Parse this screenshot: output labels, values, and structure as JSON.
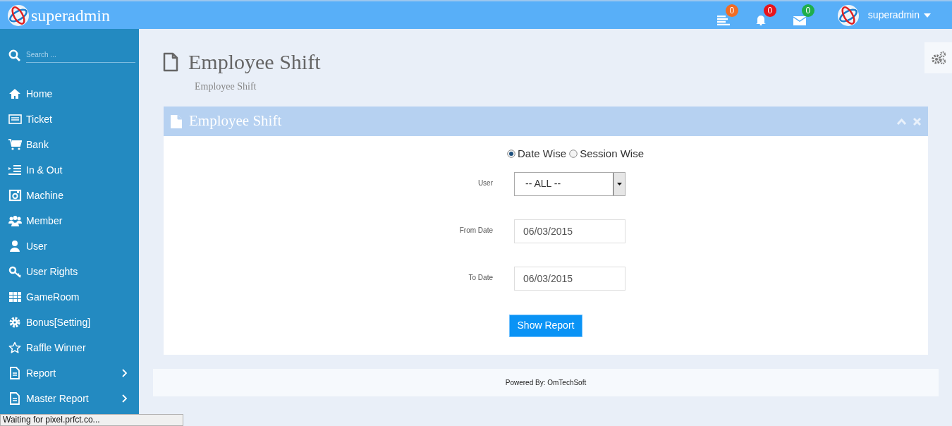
{
  "header": {
    "brand": "superadmin",
    "notifications": [
      {
        "count": "0",
        "color": "#f26c23"
      },
      {
        "count": "0",
        "color": "#e8141b"
      },
      {
        "count": "0",
        "color": "#1fae4b"
      }
    ],
    "user": "superadmin"
  },
  "sidebar": {
    "search_placeholder": "Search ...",
    "items": [
      {
        "label": "Home",
        "has_submenu": false
      },
      {
        "label": "Ticket",
        "has_submenu": false
      },
      {
        "label": "Bank",
        "has_submenu": false
      },
      {
        "label": "In & Out",
        "has_submenu": false
      },
      {
        "label": "Machine",
        "has_submenu": false
      },
      {
        "label": "Member",
        "has_submenu": false
      },
      {
        "label": "User",
        "has_submenu": false
      },
      {
        "label": "User Rights",
        "has_submenu": false
      },
      {
        "label": "GameRoom",
        "has_submenu": false
      },
      {
        "label": "Bonus[Setting]",
        "has_submenu": false
      },
      {
        "label": "Raffle Winner",
        "has_submenu": false
      },
      {
        "label": "Report",
        "has_submenu": true
      },
      {
        "label": "Master Report",
        "has_submenu": true
      }
    ]
  },
  "page": {
    "title": "Employee Shift",
    "subtitle": "Employee Shift"
  },
  "panel": {
    "title": "Employee Shift",
    "modes": [
      {
        "label": "Date Wise",
        "selected": true
      },
      {
        "label": "Session Wise",
        "selected": false
      }
    ],
    "fields": [
      {
        "kind": "select",
        "label": "User",
        "value": "-- ALL --"
      },
      {
        "kind": "date",
        "label": "From Date",
        "value": "06/03/2015"
      },
      {
        "kind": "date",
        "label": "To Date",
        "value": "06/03/2015"
      }
    ],
    "button": "Show Report"
  },
  "footer": "Powered By: OmTechSoft",
  "status_bar": "Waiting for pixel.prfct.co..."
}
